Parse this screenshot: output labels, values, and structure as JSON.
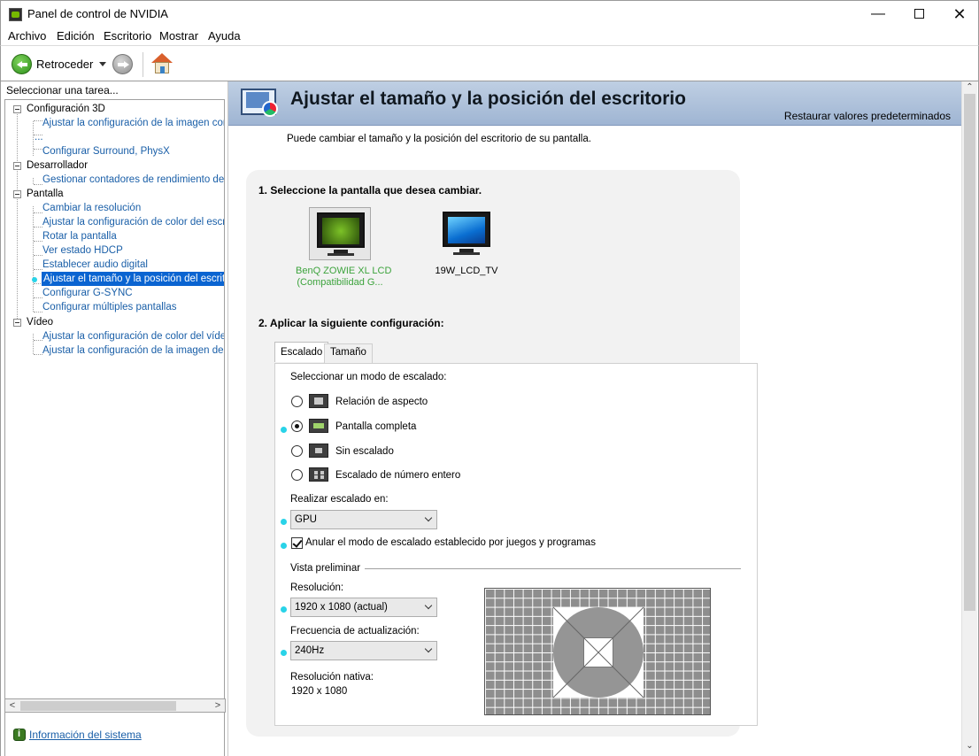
{
  "window": {
    "title": "Panel de control de NVIDIA",
    "controls": {
      "minimize": "—",
      "close": "✕"
    }
  },
  "menu": [
    "Archivo",
    "Edición",
    "Escritorio",
    "Mostrar",
    "Ayuda"
  ],
  "toolbar": {
    "back_label": "Retroceder"
  },
  "left": {
    "header": "Seleccionar una tarea...",
    "tree": [
      {
        "label": "Configuración 3D",
        "type": "cat"
      },
      {
        "label": "Ajustar la configuración de la imagen con v",
        "type": "leaf"
      },
      {
        "label": "...",
        "type": "leaf"
      },
      {
        "label": "Configurar Surround, PhysX",
        "type": "leaf"
      },
      {
        "label": "Desarrollador",
        "type": "cat"
      },
      {
        "label": "Gestionar contadores de rendimiento de GF",
        "type": "leaf"
      },
      {
        "label": "Pantalla",
        "type": "cat"
      },
      {
        "label": "Cambiar la resolución",
        "type": "leaf"
      },
      {
        "label": "Ajustar la configuración de color del escrito",
        "type": "leaf"
      },
      {
        "label": "Rotar la pantalla",
        "type": "leaf"
      },
      {
        "label": "Ver estado HDCP",
        "type": "leaf"
      },
      {
        "label": "Establecer audio digital",
        "type": "leaf"
      },
      {
        "label": "Ajustar el tamaño y la posición del escritorio",
        "type": "leaf",
        "selected": true
      },
      {
        "label": "Configurar G-SYNC",
        "type": "leaf"
      },
      {
        "label": "Configurar múltiples pantallas",
        "type": "leaf"
      },
      {
        "label": "Vídeo",
        "type": "cat"
      },
      {
        "label": "Ajustar la configuración de color del vídeo",
        "type": "leaf"
      },
      {
        "label": "Ajustar la configuración de la imagen de víd",
        "type": "leaf"
      }
    ],
    "system_info": "Información del sistema"
  },
  "main": {
    "title": "Ajustar el tamaño y la posición del escritorio",
    "restore": "Restaurar valores predeterminados",
    "description": "Puede cambiar el tamaño y la posición del escritorio de su pantalla.",
    "step1": "1. Seleccione la pantalla que desea cambiar.",
    "displays": [
      {
        "line1": "BenQ ZOWIE XL LCD",
        "line2": "(Compatibilidad G...",
        "selected": true
      },
      {
        "line1": "19W_LCD_TV",
        "line2": "",
        "selected": false
      }
    ],
    "step2": "2. Aplicar la siguiente configuración:",
    "tabs": [
      "Escalado",
      "Tamaño"
    ],
    "scaling": {
      "mode_label": "Seleccionar un modo de escalado:",
      "modes": [
        "Relación de aspecto",
        "Pantalla completa",
        "Sin escalado",
        "Escalado de número entero"
      ],
      "selected_mode": 1,
      "perform_label": "Realizar escalado en:",
      "perform_value": "GPU",
      "override_label": "Anular el modo de escalado establecido por juegos y programas",
      "override_checked": true,
      "preview_label": "Vista preliminar",
      "resolution_label": "Resolución:",
      "resolution_value": "1920 x 1080 (actual)",
      "refresh_label": "Frecuencia de actualización:",
      "refresh_value": "240Hz",
      "native_label": "Resolución nativa:",
      "native_value": "1920 x 1080"
    }
  },
  "colors": {
    "selection": "#0a64d1",
    "link": "#1a5fa8",
    "nvidia_green": "#76b900",
    "bullet": "#29d3e8"
  }
}
